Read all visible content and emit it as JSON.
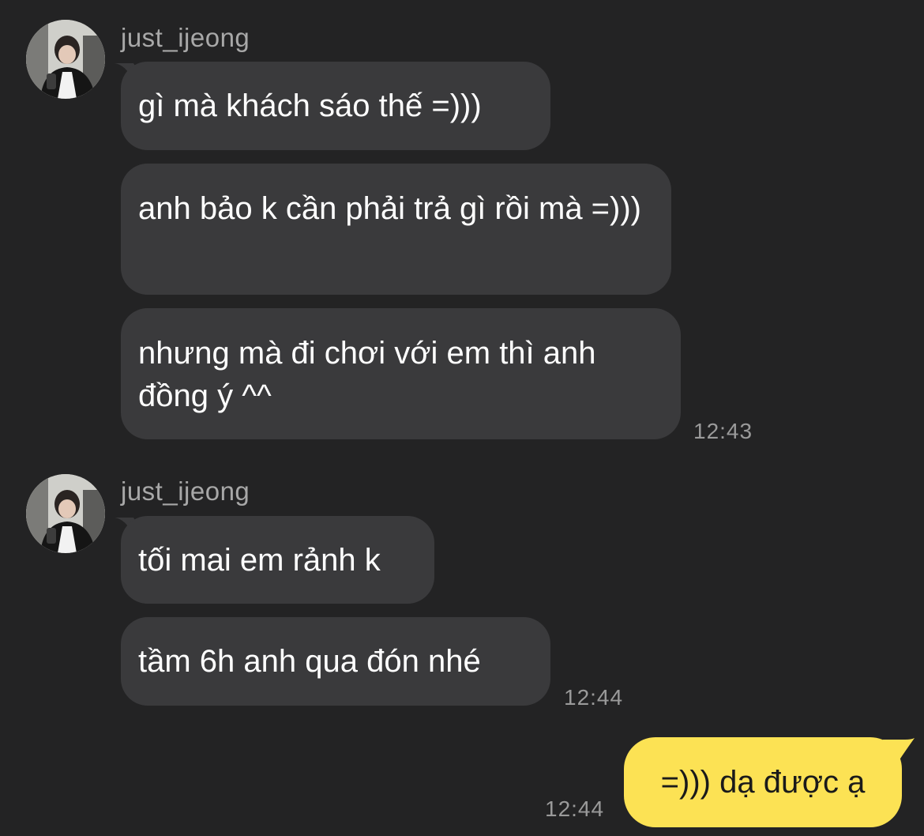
{
  "groups": [
    {
      "sender": "just_ijeong",
      "messages": [
        "gì mà khách sáo thế =)))",
        "anh bảo k cần phải trả gì rồi mà =)))",
        "nhưng mà đi chơi với em thì anh đồng ý ^^"
      ],
      "time": "12:43"
    },
    {
      "sender": "just_ijeong",
      "messages": [
        "tối mai em rảnh k",
        "tầm 6h anh qua đón nhé"
      ],
      "time": "12:44"
    }
  ],
  "outgoing": {
    "text": "=))) dạ được ạ",
    "time": "12:44"
  },
  "colors": {
    "background": "#232324",
    "incoming_bubble": "#3a3a3c",
    "outgoing_bubble": "#fce254",
    "timestamp": "#9a9a9a",
    "sender_name": "#a8a8a8"
  }
}
